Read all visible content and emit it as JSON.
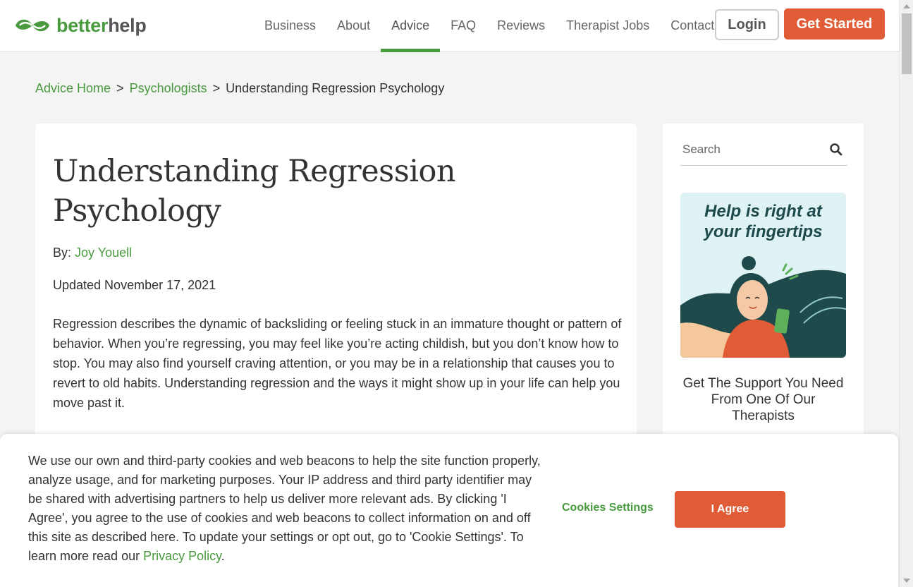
{
  "brand": {
    "name_part1": "better",
    "name_part2": "help",
    "accent": "#4a9b3f",
    "cta_color": "#e05c37"
  },
  "nav": {
    "items": [
      {
        "label": "Business",
        "active": false
      },
      {
        "label": "About",
        "active": false
      },
      {
        "label": "Advice",
        "active": true
      },
      {
        "label": "FAQ",
        "active": false
      },
      {
        "label": "Reviews",
        "active": false
      },
      {
        "label": "Therapist Jobs",
        "active": false
      },
      {
        "label": "Contact",
        "active": false
      }
    ],
    "login": "Login",
    "get_started": "Get Started"
  },
  "breadcrumb": {
    "home": "Advice Home",
    "category": "Psychologists",
    "current": "Understanding Regression Psychology",
    "separator": ">"
  },
  "article": {
    "title": "Understanding Regression Psychology",
    "by_label": "By:",
    "author": "Joy Youell",
    "updated": "Updated November 17, 2021",
    "intro": "Regression describes the dynamic of backsliding or feeling stuck in an immature thought or pattern of behavior. When you’re regressing, you may feel like you’re acting childish, but you don’t know how to stop. You may also find yourself craving attention, or you may be in a relationship that causes you to revert to old habits. Understanding regression and the ways it might show up in your life can help you move past it."
  },
  "sidebar": {
    "search_placeholder": "Search",
    "search_icon": "search-icon",
    "promo_title": "Help is right at your fingertips",
    "promo_caption": "Get The Support You Need From One Of Our Therapists"
  },
  "cookie": {
    "text": "We use our own and third-party cookies and web beacons to help the site function properly, analyze usage, and for marketing purposes. Your IP address and third party identifier may be shared with advertising partners to help us deliver more relevant ads. By clicking 'I Agree', you agree to the use of cookies and web beacons to collect information on and off this site as described here. To update your settings or opt out, go to 'Cookie Settings'. To learn more read our ",
    "privacy_link": "Privacy Policy",
    "trailing": ".",
    "settings_label": "Cookies Settings",
    "agree_label": "I Agree"
  }
}
